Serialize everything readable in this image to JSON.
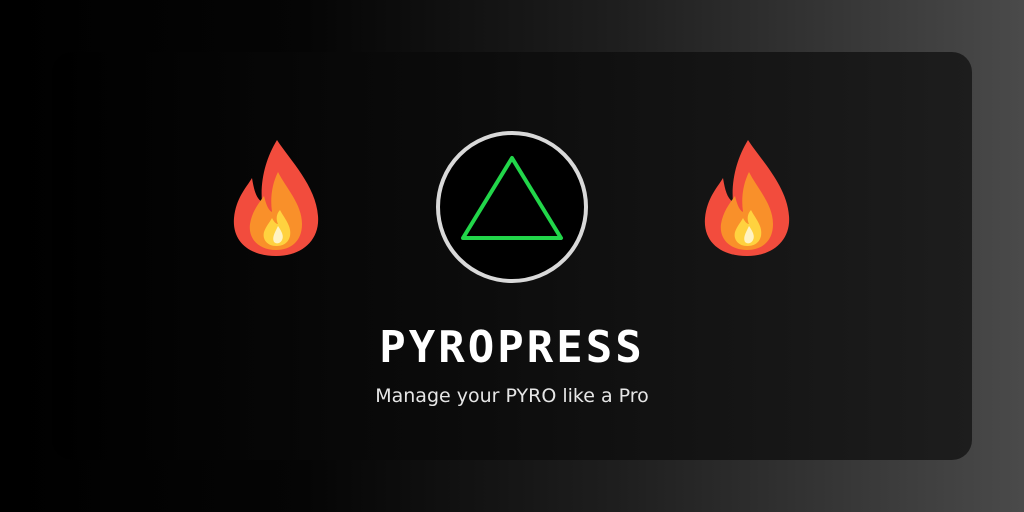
{
  "brand": {
    "name": "PYROPRESS",
    "tagline": "Manage your PYRO like a Pro"
  },
  "icons": {
    "left": "fire-icon",
    "center": "triangle-logo-icon",
    "right": "fire-icon"
  },
  "colors": {
    "accent_green": "#22d64a",
    "logo_ring": "#d9d9d9",
    "text": "#ffffff"
  }
}
